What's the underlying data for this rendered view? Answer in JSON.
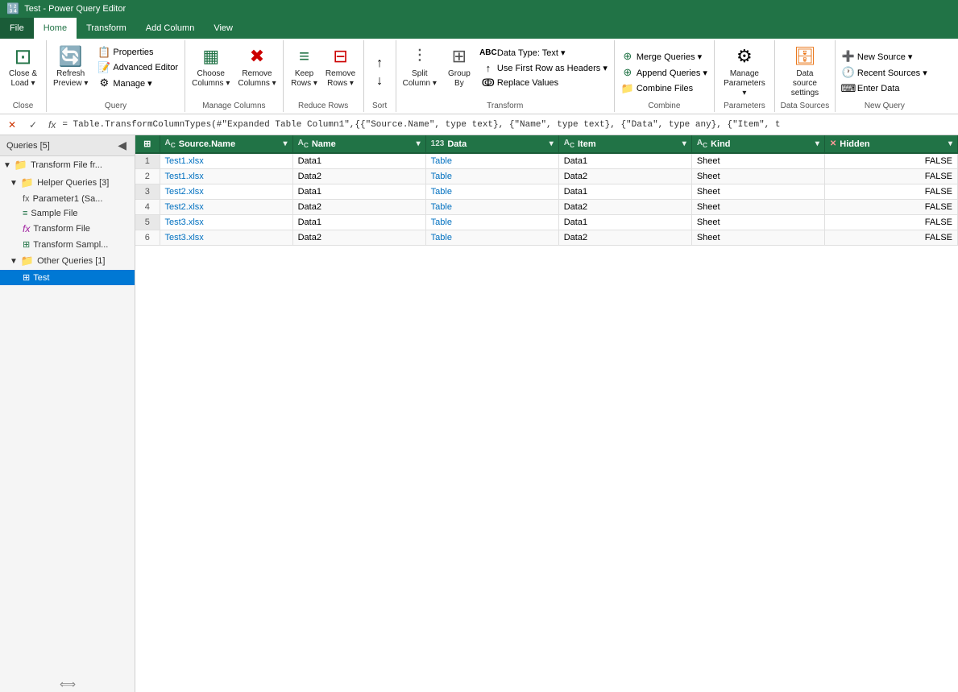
{
  "titleBar": {
    "title": "Test - Power Query Editor"
  },
  "tabs": [
    {
      "id": "file",
      "label": "File",
      "active": false
    },
    {
      "id": "home",
      "label": "Home",
      "active": true
    },
    {
      "id": "transform",
      "label": "Transform",
      "active": false
    },
    {
      "id": "add-column",
      "label": "Add Column",
      "active": false
    },
    {
      "id": "view",
      "label": "View",
      "active": false
    }
  ],
  "ribbon": {
    "groups": [
      {
        "id": "close",
        "label": "Close",
        "buttons": [
          {
            "id": "close-load",
            "label": "Close &\nLoad",
            "icon": "📥",
            "hasDropdown": true
          }
        ]
      },
      {
        "id": "query",
        "label": "Query",
        "buttons": [
          {
            "id": "refresh-preview",
            "label": "Refresh\nPreview",
            "icon": "🔄",
            "hasDropdown": true
          },
          {
            "id": "properties",
            "label": "Properties",
            "icon": "📋",
            "small": true
          },
          {
            "id": "advanced-editor",
            "label": "Advanced Editor",
            "icon": "📝",
            "small": true
          },
          {
            "id": "manage",
            "label": "Manage",
            "icon": "⚙",
            "small": true,
            "hasDropdown": true
          }
        ]
      },
      {
        "id": "manage-columns",
        "label": "Manage Columns",
        "buttons": [
          {
            "id": "choose-columns",
            "label": "Choose\nColumns",
            "icon": "▦",
            "hasDropdown": true
          },
          {
            "id": "remove-columns",
            "label": "Remove\nColumns",
            "icon": "✖",
            "hasDropdown": true
          }
        ]
      },
      {
        "id": "reduce-rows",
        "label": "Reduce Rows",
        "buttons": [
          {
            "id": "keep-rows",
            "label": "Keep\nRows",
            "icon": "≡",
            "hasDropdown": true
          },
          {
            "id": "remove-rows",
            "label": "Remove\nRows",
            "icon": "⊟",
            "hasDropdown": true
          }
        ]
      },
      {
        "id": "sort",
        "label": "Sort",
        "buttons": [
          {
            "id": "sort-asc",
            "label": "",
            "icon": "↑",
            "small": true
          },
          {
            "id": "sort-desc",
            "label": "",
            "icon": "↓",
            "small": true
          }
        ]
      },
      {
        "id": "transform",
        "label": "Transform",
        "buttons": [
          {
            "id": "split-column",
            "label": "Split\nColumn",
            "icon": "⫶",
            "hasDropdown": true
          },
          {
            "id": "group-by",
            "label": "Group\nBy",
            "icon": "⊞"
          },
          {
            "id": "data-type",
            "label": "Data Type: Text",
            "icon": "ABC",
            "small": true,
            "hasDropdown": true
          },
          {
            "id": "use-first-row",
            "label": "Use First Row as Headers",
            "icon": "↑",
            "small": true,
            "hasDropdown": true
          },
          {
            "id": "replace-values",
            "label": "Replace Values",
            "icon": "ↂ",
            "small": true
          }
        ]
      },
      {
        "id": "combine",
        "label": "Combine",
        "buttons": [
          {
            "id": "merge-queries",
            "label": "Merge Queries",
            "icon": "⊕",
            "small": true,
            "hasDropdown": true
          },
          {
            "id": "append-queries",
            "label": "Append Queries",
            "icon": "⊕",
            "small": true,
            "hasDropdown": true
          },
          {
            "id": "combine-files",
            "label": "Combine Files",
            "icon": "📁",
            "small": true
          }
        ]
      },
      {
        "id": "parameters",
        "label": "Parameters",
        "buttons": [
          {
            "id": "manage-params",
            "label": "Manage\nParameters",
            "icon": "⚙",
            "hasDropdown": true
          }
        ]
      },
      {
        "id": "data-sources",
        "label": "Data Sources",
        "buttons": [
          {
            "id": "data-source-settings",
            "label": "Data source\nsettings",
            "icon": "🗄"
          }
        ]
      },
      {
        "id": "new-query",
        "label": "New Query",
        "buttons": [
          {
            "id": "new-source",
            "label": "New Source",
            "icon": "➕",
            "small": true,
            "hasDropdown": true
          },
          {
            "id": "recent-sources",
            "label": "Recent Sources",
            "icon": "🕐",
            "small": true,
            "hasDropdown": true
          },
          {
            "id": "enter-data",
            "label": "Enter Data",
            "icon": "⌨",
            "small": true
          }
        ]
      }
    ]
  },
  "formulaBar": {
    "cancelLabel": "✕",
    "acceptLabel": "✓",
    "fxLabel": "fx",
    "formula": "= Table.TransformColumnTypes(#\"Expanded Table Column1\",{{\"Source.Name\", type text}, {\"Name\", type text}, {\"Data\", type any}, {\"Item\", t"
  },
  "sidebar": {
    "header": "Queries [5]",
    "groups": [
      {
        "id": "transform-file",
        "label": "Transform File fr...",
        "expanded": true,
        "items": []
      },
      {
        "id": "helper-queries",
        "label": "Helper Queries [3]",
        "expanded": true,
        "items": [
          {
            "id": "parameter1",
            "label": "Parameter1 (Sa...",
            "type": "param"
          },
          {
            "id": "sample-file",
            "label": "Sample File",
            "type": "doc"
          },
          {
            "id": "transform-file-fn",
            "label": "Transform File",
            "type": "func"
          },
          {
            "id": "transform-sample",
            "label": "Transform Sampl...",
            "type": "table"
          }
        ]
      },
      {
        "id": "other-queries",
        "label": "Other Queries [1]",
        "expanded": true,
        "items": [
          {
            "id": "test",
            "label": "Test",
            "type": "table",
            "selected": true
          }
        ]
      }
    ]
  },
  "table": {
    "columns": [
      {
        "id": "source-name",
        "label": "Source.Name",
        "type": "ABC"
      },
      {
        "id": "name",
        "label": "Name",
        "type": "ABC"
      },
      {
        "id": "data",
        "label": "Data",
        "type": "123"
      },
      {
        "id": "item",
        "label": "Item",
        "type": "ABC"
      },
      {
        "id": "kind",
        "label": "Kind",
        "type": "ABC"
      },
      {
        "id": "hidden",
        "label": "Hidden",
        "type": "X"
      }
    ],
    "rows": [
      {
        "num": 1,
        "sourceName": "Test1.xlsx",
        "name": "Data1",
        "data": "Table",
        "item": "Data1",
        "kind": "Sheet",
        "hidden": "FALSE"
      },
      {
        "num": 2,
        "sourceName": "Test1.xlsx",
        "name": "Data2",
        "data": "Table",
        "item": "Data2",
        "kind": "Sheet",
        "hidden": "FALSE"
      },
      {
        "num": 3,
        "sourceName": "Test2.xlsx",
        "name": "Data1",
        "data": "Table",
        "item": "Data1",
        "kind": "Sheet",
        "hidden": "FALSE"
      },
      {
        "num": 4,
        "sourceName": "Test2.xlsx",
        "name": "Data2",
        "data": "Table",
        "item": "Data2",
        "kind": "Sheet",
        "hidden": "FALSE"
      },
      {
        "num": 5,
        "sourceName": "Test3.xlsx",
        "name": "Data1",
        "data": "Table",
        "item": "Data1",
        "kind": "Sheet",
        "hidden": "FALSE"
      },
      {
        "num": 6,
        "sourceName": "Test3.xlsx",
        "name": "Data2",
        "data": "Table",
        "item": "Data2",
        "kind": "Sheet",
        "hidden": "FALSE"
      }
    ]
  }
}
